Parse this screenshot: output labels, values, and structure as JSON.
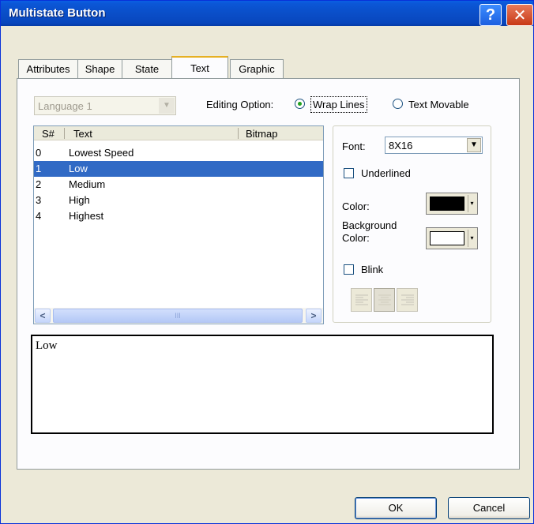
{
  "window": {
    "title": "Multistate Button",
    "help_glyph": "?",
    "close_glyph": "✕"
  },
  "tabs": [
    {
      "label": "Attributes"
    },
    {
      "label": "Shape"
    },
    {
      "label": "State"
    },
    {
      "label": "Text",
      "active": true
    },
    {
      "label": "Graphic"
    }
  ],
  "language": {
    "value": "Language 1",
    "disabled": true
  },
  "editing": {
    "label": "Editing Option:",
    "options": [
      {
        "label": "Wrap Lines",
        "checked": true
      },
      {
        "label": "Text Movable",
        "checked": false
      }
    ]
  },
  "list": {
    "columns": [
      "S#",
      "Text",
      "Bitmap"
    ],
    "rows": [
      {
        "num": "0",
        "text": "Lowest Speed",
        "bitmap": ""
      },
      {
        "num": "1",
        "text": "Low",
        "bitmap": "",
        "selected": true
      },
      {
        "num": "2",
        "text": "Medium",
        "bitmap": ""
      },
      {
        "num": "3",
        "text": "High",
        "bitmap": ""
      },
      {
        "num": "4",
        "text": "Highest",
        "bitmap": ""
      }
    ],
    "scroll_left": "<",
    "scroll_right": ">",
    "thumb_grip": "III"
  },
  "font": {
    "font_label": "Font:",
    "font_value": "8X16",
    "dropdown_glyph": "▼",
    "underlined_label": "Underlined",
    "underlined_checked": false,
    "color_label": "Color:",
    "color_value": "#000000",
    "background_label_line1": "Background",
    "background_label_line2": "Color:",
    "background_value": "#ffffff",
    "color_drop_glyph": "▾",
    "blink_label": "Blink",
    "blink_checked": false,
    "alignment_selected": "center"
  },
  "preview_text": "Low",
  "buttons": {
    "ok": "OK",
    "cancel": "Cancel"
  }
}
